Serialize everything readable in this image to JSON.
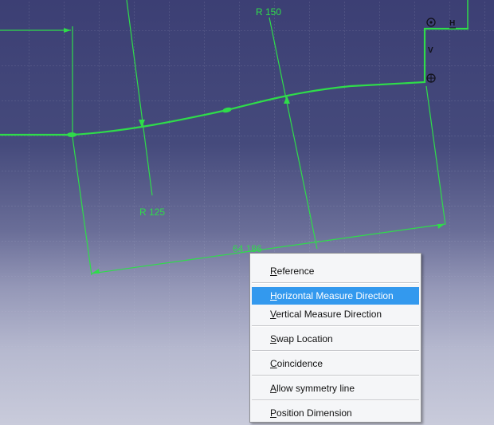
{
  "canvas": {
    "radius_top_label": "R 150",
    "radius_bottom_label": "R 125",
    "length_label": "64.186",
    "horizontal_constraint_symbol": "H",
    "vertical_constraint_symbol": "V",
    "sketch_color": "#2fdc4a",
    "background_top": "#3c3f74",
    "background_bottom": "#c9cbdb"
  },
  "context_menu": {
    "items": [
      {
        "mnemonic": "R",
        "rest": "eference"
      },
      {
        "mnemonic": "H",
        "rest": "orizontal Measure Direction"
      },
      {
        "mnemonic": "V",
        "rest": "ertical Measure Direction"
      },
      {
        "mnemonic": "S",
        "rest": "wap Location"
      },
      {
        "mnemonic": "C",
        "rest": "oincidence"
      },
      {
        "mnemonic": "A",
        "rest": "llow symmetry line"
      },
      {
        "mnemonic": "P",
        "rest": "osition Dimension"
      }
    ],
    "highlight_color": "#3399ee"
  }
}
